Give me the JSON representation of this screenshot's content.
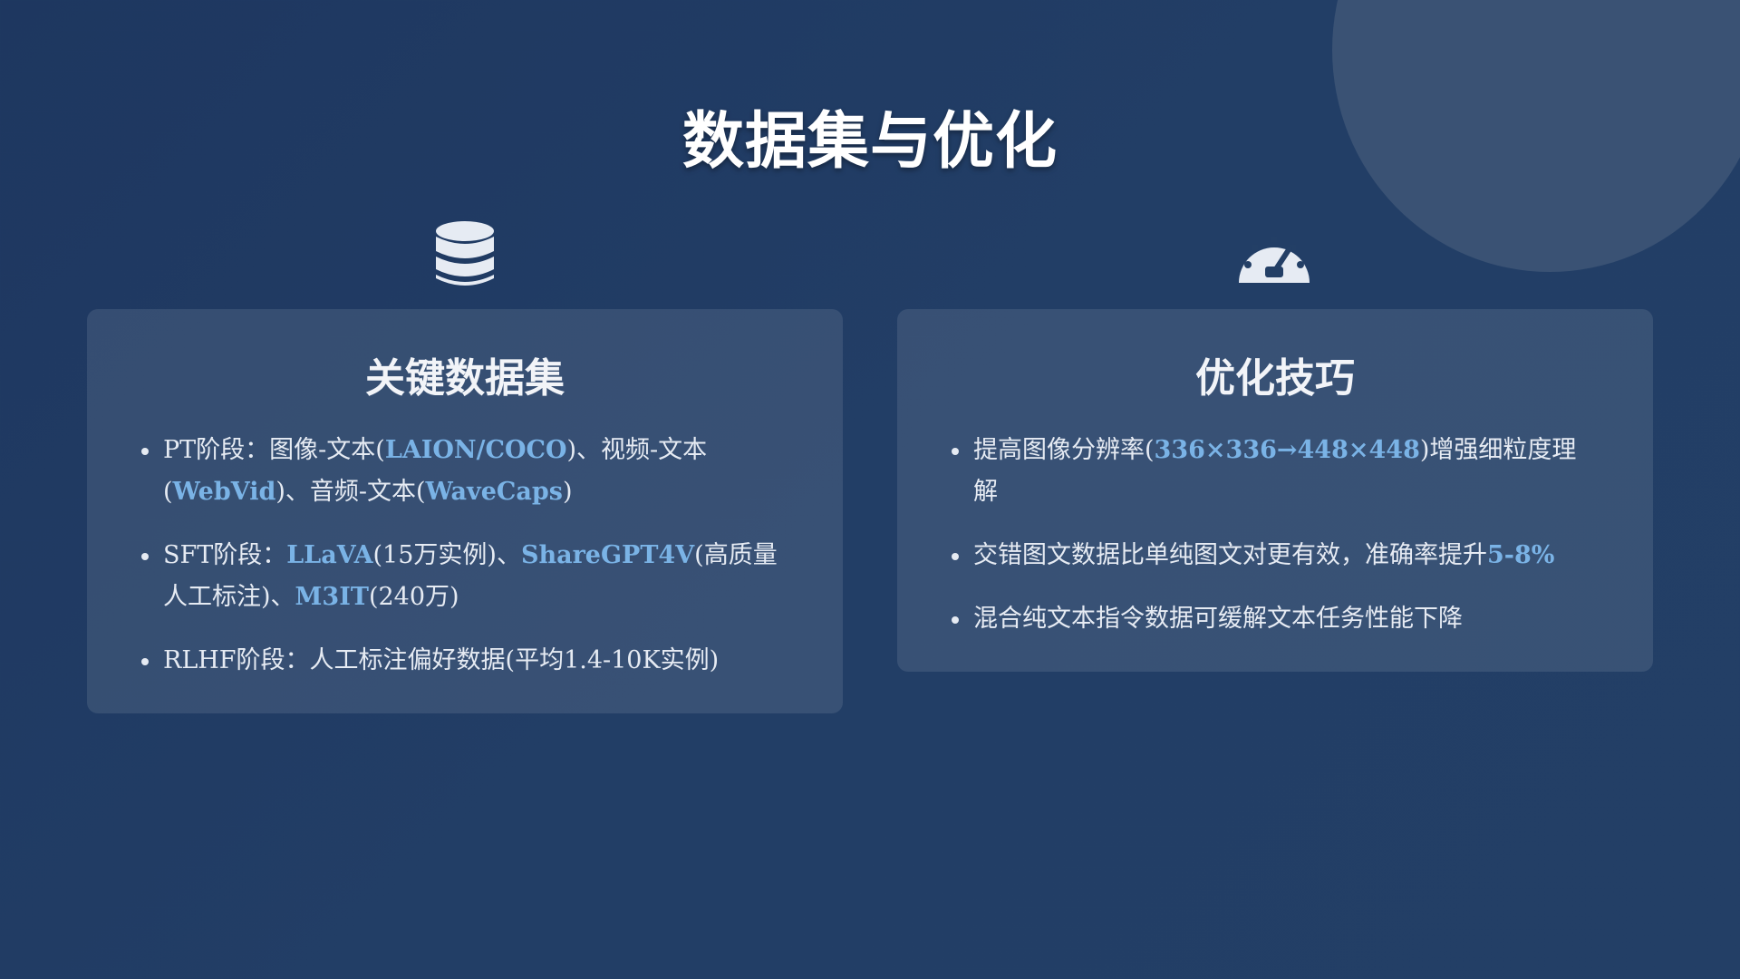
{
  "page": {
    "title": "数据集与优化"
  },
  "colors": {
    "background": "#1e3760",
    "card": "#3a5274",
    "highlight": "#7ab3e6",
    "text": "#e6ebf3"
  },
  "datasets_card": {
    "icon": "database-icon",
    "heading": "关键数据集",
    "items": [
      {
        "parts": [
          "PT阶段：图像-文本(",
          "LAION/COCO",
          ")、视频-文本",
          "(",
          "WebVid",
          ")、音频-文本(",
          "WaveCaps",
          ")"
        ]
      },
      {
        "parts": [
          "SFT阶段：",
          "LLaVA",
          "(15万实例)、",
          "ShareGPT4V",
          "(高质量",
          "人工标注)、",
          "M3IT",
          "(240万)"
        ]
      },
      {
        "parts": [
          "RLHF阶段：人工标注偏好数据(平均1.4-10K实例)"
        ]
      }
    ]
  },
  "optimization_card": {
    "icon": "speedometer-icon",
    "heading": "优化技巧",
    "items": [
      {
        "parts": [
          "提高图像分辨率(",
          "336×336→448×448",
          ")增强细粒度理",
          "解"
        ]
      },
      {
        "parts": [
          "交错图文数据比单纯图文对更有效，准确率提升",
          "5-8%"
        ]
      },
      {
        "parts": [
          "混合纯文本指令数据可缓解文本任务性能下降"
        ]
      }
    ]
  }
}
